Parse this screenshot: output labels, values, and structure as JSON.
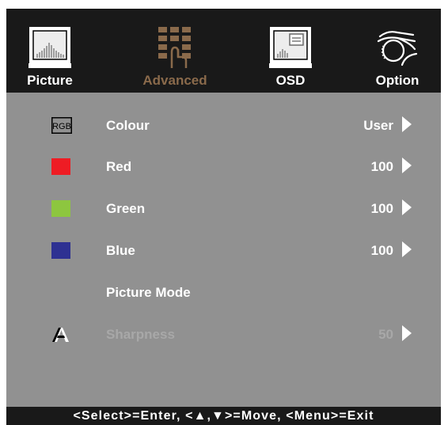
{
  "tabs": [
    {
      "label": "Picture",
      "icon": "picture-icon",
      "active": false
    },
    {
      "label": "Advanced",
      "icon": "advanced-icon",
      "active": true
    },
    {
      "label": "OSD",
      "icon": "osd-icon",
      "active": false
    },
    {
      "label": "Option",
      "icon": "option-icon",
      "active": false
    }
  ],
  "rows": [
    {
      "icon": "rgb-icon",
      "icon_text": "RGB",
      "label": "Colour",
      "value": "User",
      "enabled": true
    },
    {
      "icon": "red-swatch-icon",
      "swatch_color": "#ee1c24",
      "label": "Red",
      "value": "100",
      "enabled": true
    },
    {
      "icon": "green-swatch-icon",
      "swatch_color": "#8dc63f",
      "label": "Green",
      "value": "100",
      "enabled": true
    },
    {
      "icon": "blue-swatch-icon",
      "swatch_color": "#2e3192",
      "label": "Blue",
      "value": "100",
      "enabled": true
    },
    {
      "icon": "",
      "label": "Picture Mode",
      "value": "",
      "enabled": true
    },
    {
      "icon": "sharpness-icon",
      "label": "Sharpness",
      "value": "50",
      "enabled": false
    }
  ],
  "footer": {
    "hint": "<Select>=Enter, <▲,▼>=Move, <Menu>=Exit"
  },
  "colors": {
    "panel_bg": "#919191",
    "header_bg": "#191919",
    "active_tab": "#8a6a4b",
    "text": "#ffffff",
    "disabled_text": "#a8a8a8"
  }
}
